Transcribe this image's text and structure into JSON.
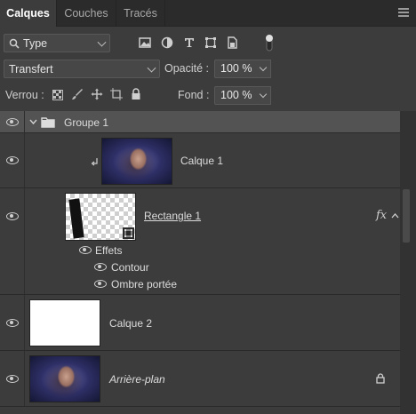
{
  "tabs": [
    {
      "label": "Calques",
      "active": true
    },
    {
      "label": "Couches",
      "active": false
    },
    {
      "label": "Tracés",
      "active": false
    }
  ],
  "filter": {
    "selected": "Type",
    "icons": [
      "image-filter-icon",
      "adjustment-filter-icon",
      "type-filter-icon",
      "shape-filter-icon",
      "smart-object-filter-icon",
      "filter-toggle-icon"
    ]
  },
  "blend": {
    "selected": "Transfert"
  },
  "opacity": {
    "label": "Opacité :",
    "value": "100 %"
  },
  "lock": {
    "label": "Verrou :",
    "icons": [
      "lock-transparent-pixels-icon",
      "lock-image-pixels-icon",
      "lock-position-icon",
      "lock-artboard-icon",
      "lock-all-icon"
    ]
  },
  "fill": {
    "label": "Fond :",
    "value": "100 %"
  },
  "layers": {
    "group": {
      "name": "Groupe 1"
    },
    "calque1": {
      "name": "Calque 1"
    },
    "rectangle": {
      "name": "Rectangle 1",
      "fx": "fx"
    },
    "effects": {
      "label": "Effets",
      "items": [
        "Contour",
        "Ombre portée"
      ]
    },
    "calque2": {
      "name": "Calque 2"
    },
    "background": {
      "name": "Arrière-plan"
    }
  },
  "colors": {
    "panel": "#3c3c3c",
    "tabbar": "#2b2b2b",
    "group_row": "#535353",
    "text": "#d8d8d8"
  }
}
